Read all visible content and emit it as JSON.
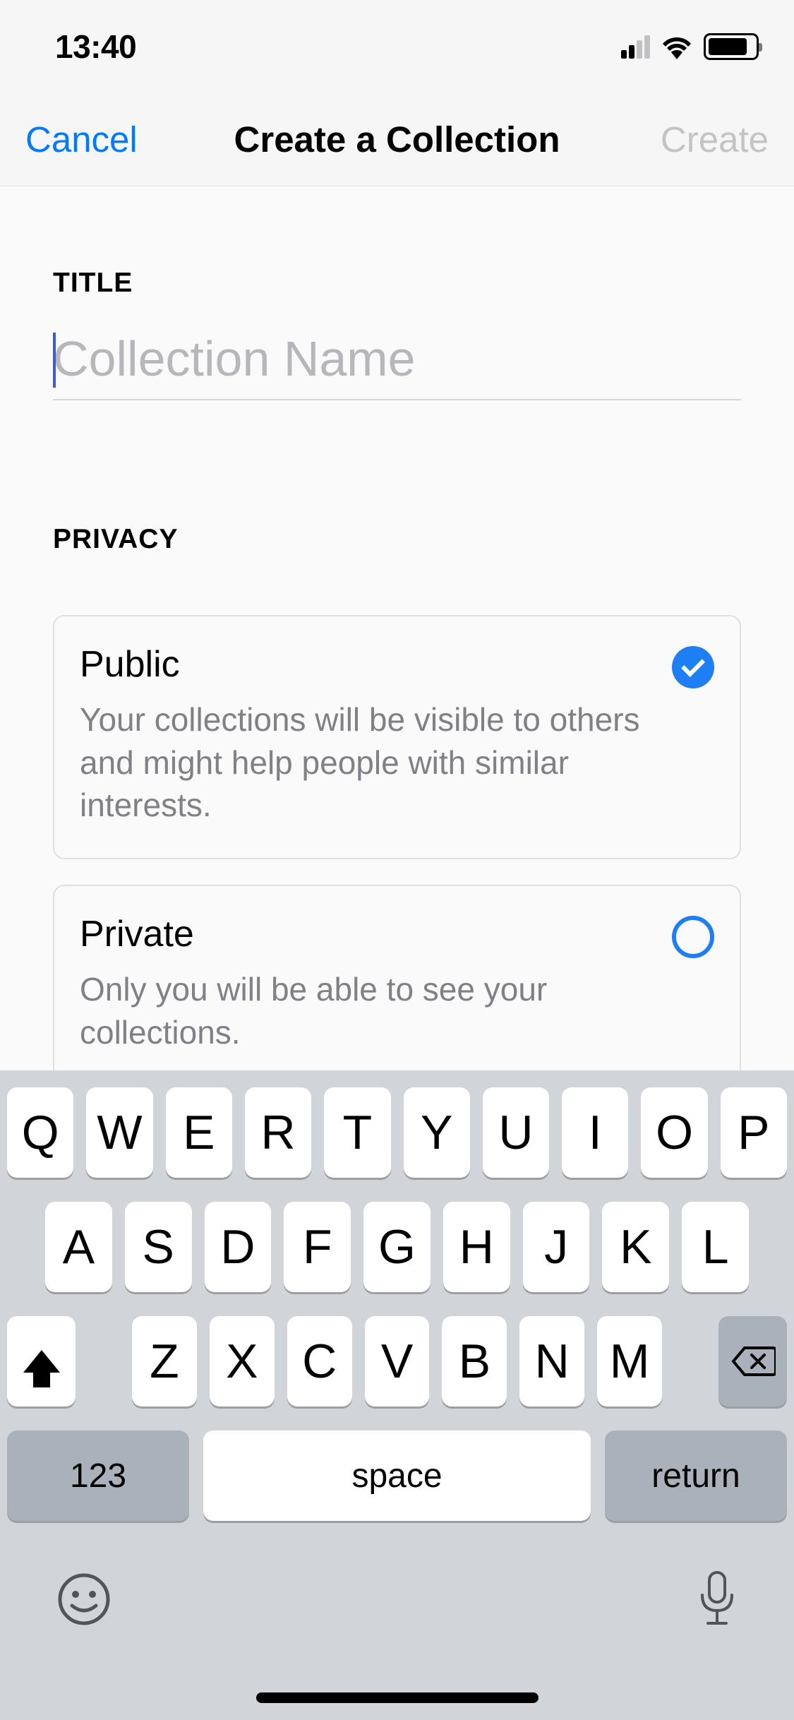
{
  "status": {
    "time": "13:40"
  },
  "nav": {
    "left": "Cancel",
    "title": "Create a Collection",
    "right": "Create"
  },
  "sections": {
    "title_label": "TITLE",
    "title_placeholder": "Collection Name",
    "privacy_label": "PRIVACY"
  },
  "privacy": {
    "public": {
      "title": "Public",
      "desc": "Your collections will be visible to others and might help people with similar interests.",
      "selected": true
    },
    "private": {
      "title": "Private",
      "desc": "Only you will be able to see your collections.",
      "selected": false
    }
  },
  "keyboard": {
    "row1": [
      "Q",
      "W",
      "E",
      "R",
      "T",
      "Y",
      "U",
      "I",
      "O",
      "P"
    ],
    "row2": [
      "A",
      "S",
      "D",
      "F",
      "G",
      "H",
      "J",
      "K",
      "L"
    ],
    "row3": [
      "Z",
      "X",
      "C",
      "V",
      "B",
      "N",
      "M"
    ],
    "numbers": "123",
    "space": "space",
    "return": "return"
  }
}
